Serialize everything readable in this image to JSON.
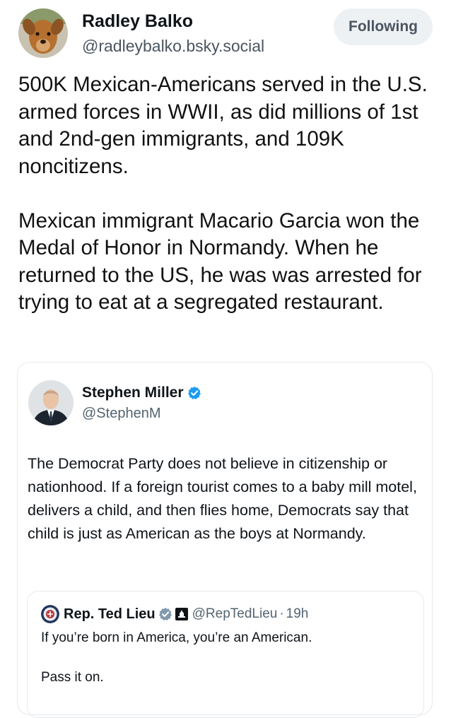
{
  "post": {
    "author_name": "Radley Balko",
    "author_handle": "@radleybalko.bsky.social",
    "follow_label": "Following",
    "paragraphs": [
      "500K Mexican-Americans served in the U.S. armed forces in WWII, as did millions of 1st and 2nd-gen immigrants, and 109K noncitizens.",
      "Mexican immigrant Macario Garcia won the Medal of Honor in Normandy. When he returned to the US, he was was arrested for trying to eat at a segregated restaurant."
    ]
  },
  "quote": {
    "author_name": "Stephen Miller",
    "author_handle": "@StephenM",
    "text": "The Democrat Party does not believe in citizenship or nationhood. If a foreign tourist comes to a baby mill motel, delivers a child, and then flies home, Democrats say that child is just as American as the boys at Normandy.",
    "badge_color": "#1d9bf0"
  },
  "nested_quote": {
    "author_name": "Rep. Ted Lieu",
    "author_handle": "@RepTedLieu",
    "separator": "·",
    "time": "19h",
    "line1": "If you’re born in America, you’re an American.",
    "line2": "Pass it on.",
    "badge_color": "#829aab"
  },
  "icons": {
    "main_avatar": "dog-avatar",
    "quote_avatar": "man-in-suit-avatar",
    "verified": "blue-verified-check-icon",
    "government": "gray-government-check-icon",
    "capitol": "capitol-building-icon",
    "seal": "congressional-seal-icon"
  }
}
